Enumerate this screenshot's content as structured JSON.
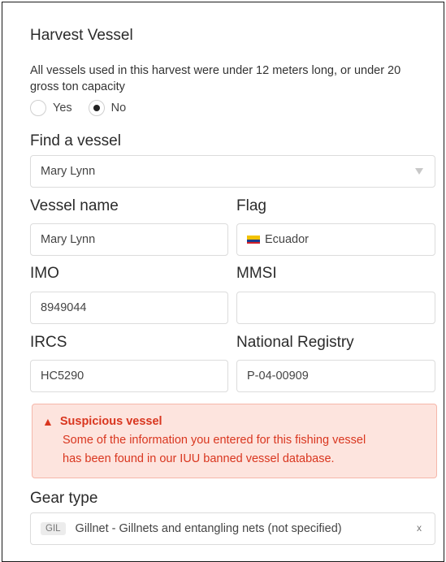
{
  "section": {
    "title": "Harvest Vessel",
    "description": "All vessels used in this harvest were under 12 meters long, or under 20 gross ton capacity",
    "radio_yes": "Yes",
    "radio_no": "No",
    "selected": "No"
  },
  "find_vessel": {
    "label": "Find a vessel",
    "value": "Mary Lynn"
  },
  "vessel_name": {
    "label": "Vessel name",
    "value": "Mary Lynn"
  },
  "flag": {
    "label": "Flag",
    "value": "Ecuador",
    "colors": [
      "#f2c200",
      "#1c3e8c",
      "#d2202a"
    ]
  },
  "imo": {
    "label": "IMO",
    "value": "8949044"
  },
  "mmsi": {
    "label": "MMSI",
    "value": ""
  },
  "ircs": {
    "label": "IRCS",
    "value": "HC5290"
  },
  "national_registry": {
    "label": "National Registry",
    "value": "P-04-00909"
  },
  "alert": {
    "title": "Suspicious vessel",
    "line1": "Some of the information you entered for this fishing vessel",
    "line2": "has been found in our IUU banned vessel database.",
    "icon": "warning-icon",
    "color": "#d9361f",
    "background": "#fde4de"
  },
  "gear": {
    "label": "Gear type",
    "tag": "GIL",
    "value": "Gillnet - Gillnets and entangling nets (not specified)",
    "clear": "x"
  }
}
